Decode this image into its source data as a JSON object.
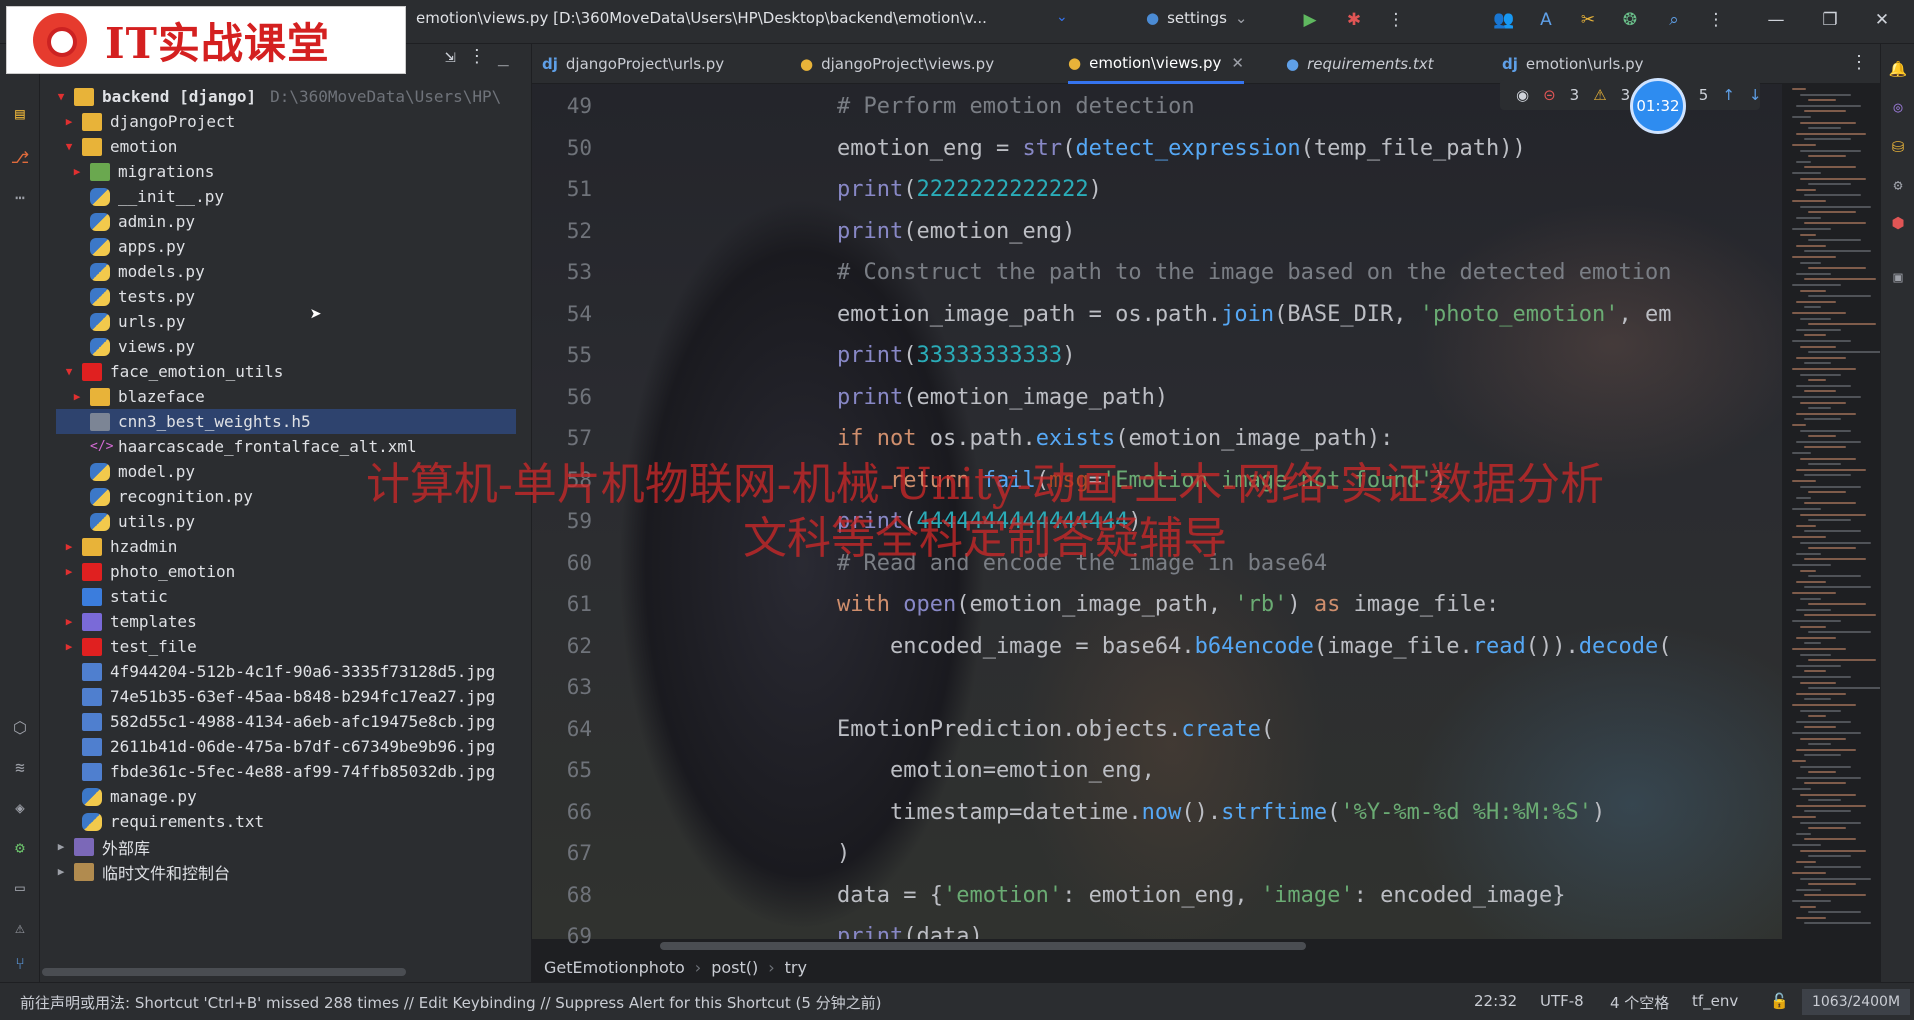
{
  "logo": {
    "text": "IT实战课堂"
  },
  "titlebar": {
    "path": "emotion\\views.py [D:\\360MoveData\\Users\\HP\\Desktop\\backend\\emotion\\v...",
    "run_config": "settings"
  },
  "project": {
    "root_label": "backend [django]",
    "root_path": "D:\\360MoveData\\Users\\HP\\",
    "items": [
      {
        "label": "djangoProject"
      },
      {
        "label": "emotion"
      },
      {
        "label": "migrations"
      },
      {
        "label": "__init__.py"
      },
      {
        "label": "admin.py"
      },
      {
        "label": "apps.py"
      },
      {
        "label": "models.py"
      },
      {
        "label": "tests.py"
      },
      {
        "label": "urls.py"
      },
      {
        "label": "views.py"
      },
      {
        "label": "face_emotion_utils"
      },
      {
        "label": "blazeface"
      },
      {
        "label": "cnn3_best_weights.h5"
      },
      {
        "label": "haarcascade_frontalface_alt.xml"
      },
      {
        "label": "model.py"
      },
      {
        "label": "recognition.py"
      },
      {
        "label": "utils.py"
      },
      {
        "label": "hzadmin"
      },
      {
        "label": "photo_emotion"
      },
      {
        "label": "static"
      },
      {
        "label": "templates"
      },
      {
        "label": "test_file"
      },
      {
        "label": "4f944204-512b-4c1f-90a6-3335f73128d5.jpg"
      },
      {
        "label": "74e51b35-63ef-45aa-b848-b294fc17ea27.jpg"
      },
      {
        "label": "582d55c1-4988-4134-a6eb-afc19475e8cb.jpg"
      },
      {
        "label": "2611b41d-06de-475a-b7df-c67349be9b96.jpg"
      },
      {
        "label": "fbde361c-5fec-4e88-af99-74ffb85032db.jpg"
      },
      {
        "label": "manage.py"
      },
      {
        "label": "requirements.txt"
      },
      {
        "label": "外部库"
      },
      {
        "label": "临时文件和控制台"
      }
    ]
  },
  "tabs": [
    {
      "label": "djangoProject\\urls.py",
      "icon": "dj"
    },
    {
      "label": "djangoProject\\views.py",
      "icon": "python"
    },
    {
      "label": "emotion\\views.py",
      "icon": "python",
      "active": true
    },
    {
      "label": "requirements.txt",
      "icon": "python"
    },
    {
      "label": "emotion\\urls.py",
      "icon": "dj"
    }
  ],
  "inspections": {
    "warnings": "3",
    "errors": "3",
    "weak": "5",
    "timer": "01:32"
  },
  "code": {
    "line_numbers": [
      "49",
      "50",
      "51",
      "52",
      "53",
      "54",
      "55",
      "56",
      "57",
      "58",
      "59",
      "60",
      "61",
      "62",
      "63",
      "64",
      "65",
      "66",
      "67",
      "68",
      "69"
    ],
    "lines": [
      "# Perform emotion detection",
      "emotion_eng = str(detect_expression(temp_file_path))",
      "print(2222222222222)",
      "print(emotion_eng)",
      "# Construct the path to the image based on the detected emotion",
      "emotion_image_path = os.path.join(BASE_DIR, 'photo_emotion', em",
      "print(33333333333)",
      "print(emotion_image_path)",
      "if not os.path.exists(emotion_image_path):",
      "    return fail(msg='Emotion image not found')",
      "print(4444444444444444)",
      "# Read and encode the image in base64",
      "with open(emotion_image_path, 'rb') as image_file:",
      "    encoded_image = base64.b64encode(image_file.read()).decode(",
      "",
      "EmotionPrediction.objects.create(",
      "    emotion=emotion_eng,",
      "    timestamp=datetime.now().strftime('%Y-%m-%d %H:%M:%S')",
      ")",
      "data = {'emotion': emotion_eng, 'image': encoded_image}",
      "print(data)"
    ]
  },
  "breadcrumb": [
    "GetEmotionphoto",
    "post()",
    "try"
  ],
  "status": {
    "message": "前往声明或用法: Shortcut 'Ctrl+B' missed 288 times // Edit Keybinding // Suppress Alert for this Shortcut (5 分钟之前)",
    "position": "22:32",
    "encoding": "UTF-8",
    "indent": "4 个空格",
    "interpreter": "tf_env",
    "memory": "1063/2400M"
  },
  "watermark": {
    "line1": "计算机-单片机物联网-机械-Unity-动画-土木-网络-实证数据分析",
    "line2": "文科等全科定制答疑辅导"
  },
  "colors": {
    "accent": "#3574f0",
    "selection": "#2e436e",
    "watermark": "#d22828"
  }
}
